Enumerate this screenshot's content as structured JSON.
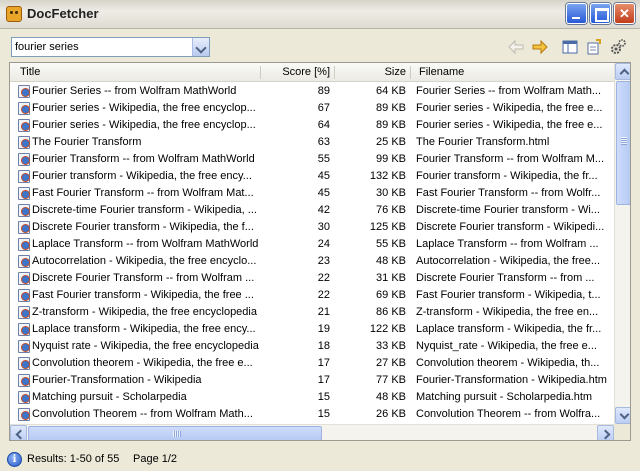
{
  "window": {
    "title": "DocFetcher"
  },
  "search": {
    "value": "fourier series"
  },
  "icons": {
    "app": "docfetcher-app-icon",
    "back": "back-arrow-icon",
    "forward": "forward-arrow-icon",
    "view": "layout-view-icon",
    "prefs": "preferences-icon",
    "settings": "gear-icon",
    "info": "info-icon",
    "document": "html-document-icon"
  },
  "colors": {
    "accent": "#2759d6",
    "close": "#c23d1a",
    "arrow": "#e8a826"
  },
  "table": {
    "columns": [
      "Title",
      "Score [%]",
      "Size",
      "Filename"
    ],
    "rows": [
      {
        "title": "Fourier Series -- from Wolfram MathWorld",
        "score": "89",
        "size": "64 KB",
        "filename": "Fourier Series -- from Wolfram Math..."
      },
      {
        "title": "Fourier series - Wikipedia, the free encyclop...",
        "score": "67",
        "size": "89 KB",
        "filename": "Fourier series - Wikipedia, the free e..."
      },
      {
        "title": "Fourier series - Wikipedia, the free encyclop...",
        "score": "64",
        "size": "89 KB",
        "filename": "Fourier series - Wikipedia, the free e..."
      },
      {
        "title": "The Fourier Transform",
        "score": "63",
        "size": "25 KB",
        "filename": "The Fourier Transform.html"
      },
      {
        "title": "Fourier Transform -- from Wolfram MathWorld",
        "score": "55",
        "size": "99 KB",
        "filename": "Fourier Transform -- from Wolfram M..."
      },
      {
        "title": "Fourier transform - Wikipedia, the free ency...",
        "score": "45",
        "size": "132 KB",
        "filename": "Fourier transform - Wikipedia, the fr..."
      },
      {
        "title": "Fast Fourier Transform -- from Wolfram Mat...",
        "score": "45",
        "size": "30 KB",
        "filename": "Fast Fourier Transform -- from Wolfr..."
      },
      {
        "title": "Discrete-time Fourier transform - Wikipedia, ...",
        "score": "42",
        "size": "76 KB",
        "filename": "Discrete-time Fourier transform - Wi..."
      },
      {
        "title": "Discrete Fourier transform - Wikipedia, the f...",
        "score": "30",
        "size": "125 KB",
        "filename": "Discrete Fourier transform - Wikipedi..."
      },
      {
        "title": "Laplace Transform -- from Wolfram MathWorld",
        "score": "24",
        "size": "55 KB",
        "filename": "Laplace Transform -- from Wolfram ..."
      },
      {
        "title": "Autocorrelation - Wikipedia, the free encyclo...",
        "score": "23",
        "size": "48 KB",
        "filename": "Autocorrelation - Wikipedia, the free..."
      },
      {
        "title": "Discrete Fourier Transform -- from Wolfram ...",
        "score": "22",
        "size": "31 KB",
        "filename": "Discrete Fourier Transform -- from ..."
      },
      {
        "title": "Fast Fourier transform - Wikipedia, the free ...",
        "score": "22",
        "size": "69 KB",
        "filename": "Fast Fourier transform - Wikipedia, t..."
      },
      {
        "title": "Z-transform - Wikipedia, the free encyclopedia",
        "score": "21",
        "size": "86 KB",
        "filename": "Z-transform - Wikipedia, the free en..."
      },
      {
        "title": "Laplace transform - Wikipedia, the free ency...",
        "score": "19",
        "size": "122 KB",
        "filename": "Laplace transform - Wikipedia, the fr..."
      },
      {
        "title": "Nyquist rate - Wikipedia, the free encyclopedia",
        "score": "18",
        "size": "33 KB",
        "filename": "Nyquist_rate - Wikipedia, the free e..."
      },
      {
        "title": "Convolution theorem - Wikipedia, the free e...",
        "score": "17",
        "size": "27 KB",
        "filename": "Convolution theorem - Wikipedia, th..."
      },
      {
        "title": "Fourier-Transformation - Wikipedia",
        "score": "17",
        "size": "77 KB",
        "filename": "Fourier-Transformation - Wikipedia.htm"
      },
      {
        "title": "Matching pursuit - Scholarpedia",
        "score": "15",
        "size": "48 KB",
        "filename": "Matching pursuit - Scholarpedia.htm"
      },
      {
        "title": "Convolution Theorem -- from Wolfram Math...",
        "score": "15",
        "size": "26 KB",
        "filename": "Convolution Theorem -- from Wolfra..."
      }
    ]
  },
  "status": {
    "results": "Results: 1-50 of 55",
    "page": "Page 1/2"
  }
}
